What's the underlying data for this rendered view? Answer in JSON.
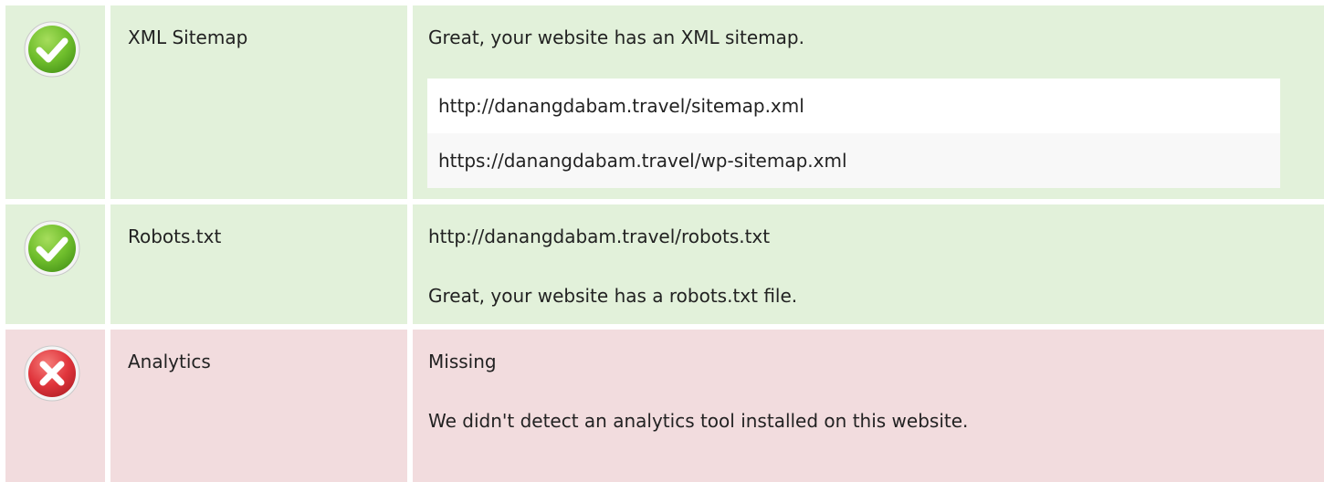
{
  "colors": {
    "pass_background": "#e2f1da",
    "fail_background": "#f2dcde",
    "pass_icon": "#6fbe2c",
    "fail_icon": "#e0353c"
  },
  "rows": [
    {
      "status": "pass",
      "icon": "check-icon",
      "name": "XML Sitemap",
      "message": "Great, your website has an XML sitemap.",
      "urls": [
        "http://danangdabam.travel/sitemap.xml",
        "https://danangdabam.travel/wp-sitemap.xml"
      ]
    },
    {
      "status": "pass",
      "icon": "check-icon",
      "name": "Robots.txt",
      "line1": "http://danangdabam.travel/robots.txt",
      "line2": "Great, your website has a robots.txt file."
    },
    {
      "status": "fail",
      "icon": "cross-icon",
      "name": "Analytics",
      "line1": "Missing",
      "line2": "We didn't detect an analytics tool installed on this website."
    }
  ]
}
